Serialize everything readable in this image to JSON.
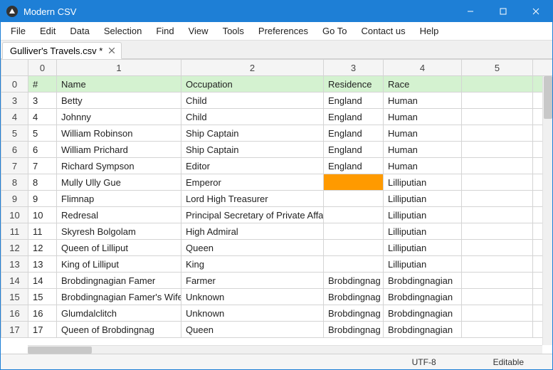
{
  "app": {
    "title": "Modern CSV"
  },
  "window_controls": {
    "min": "min",
    "max": "max",
    "close": "close"
  },
  "menu": [
    "File",
    "Edit",
    "Data",
    "Selection",
    "Find",
    "View",
    "Tools",
    "Preferences",
    "Go To",
    "Contact us",
    "Help"
  ],
  "tab": {
    "label": "Gulliver's Travels.csv *"
  },
  "columns": {
    "rowhdr": "",
    "c0": "0",
    "c1": "1",
    "c2": "2",
    "c3": "3",
    "c4": "4",
    "c5": "5",
    "c6": ""
  },
  "header_row": {
    "idx": "0",
    "c0": "#",
    "c1": "Name",
    "c2": "Occupation",
    "c3": "Residence",
    "c4": "Race",
    "c5": "",
    "c6": ""
  },
  "rows": [
    {
      "idx": "3",
      "c0": "3",
      "c1": "Betty",
      "c2": "Child",
      "c3": "England",
      "c4": "Human",
      "c5": "",
      "c6": ""
    },
    {
      "idx": "4",
      "c0": "4",
      "c1": "Johnny",
      "c2": "Child",
      "c3": "England",
      "c4": "Human",
      "c5": "",
      "c6": ""
    },
    {
      "idx": "5",
      "c0": "5",
      "c1": "William Robinson",
      "c2": "Ship Captain",
      "c3": "England",
      "c4": "Human",
      "c5": "",
      "c6": ""
    },
    {
      "idx": "6",
      "c0": "6",
      "c1": "William Prichard",
      "c2": "Ship Captain",
      "c3": "England",
      "c4": "Human",
      "c5": "",
      "c6": ""
    },
    {
      "idx": "7",
      "c0": "7",
      "c1": "Richard Sympson",
      "c2": "Editor",
      "c3": "England",
      "c4": "Human",
      "c5": "",
      "c6": ""
    },
    {
      "idx": "8",
      "c0": "8",
      "c1": "Mully Ully Gue",
      "c2": "Emperor",
      "c3": "",
      "c4": "Lilliputian",
      "c5": "",
      "c6": "",
      "hl": "c3"
    },
    {
      "idx": "9",
      "c0": "9",
      "c1": "Flimnap",
      "c2": "Lord High Treasurer",
      "c3": "",
      "c4": "Lilliputian",
      "c5": "",
      "c6": ""
    },
    {
      "idx": "10",
      "c0": "10",
      "c1": "Redresal",
      "c2": "Principal Secretary of Private Affairs",
      "c3": "",
      "c4": "Lilliputian",
      "c5": "",
      "c6": ""
    },
    {
      "idx": "11",
      "c0": "11",
      "c1": "Skyresh Bolgolam",
      "c2": "High Admiral",
      "c3": "",
      "c4": "Lilliputian",
      "c5": "",
      "c6": ""
    },
    {
      "idx": "12",
      "c0": "12",
      "c1": "Queen of Lilliput",
      "c2": "Queen",
      "c3": "",
      "c4": "Lilliputian",
      "c5": "",
      "c6": ""
    },
    {
      "idx": "13",
      "c0": "13",
      "c1": "King of Lilliput",
      "c2": "King",
      "c3": "",
      "c4": "Lilliputian",
      "c5": "",
      "c6": ""
    },
    {
      "idx": "14",
      "c0": "14",
      "c1": "Brobdingnagian Famer",
      "c2": "Farmer",
      "c3": "Brobdingnag",
      "c4": "Brobdingnagian",
      "c5": "",
      "c6": ""
    },
    {
      "idx": "15",
      "c0": "15",
      "c1": "Brobdingnagian Famer's Wife",
      "c2": "Unknown",
      "c3": "Brobdingnag",
      "c4": "Brobdingnagian",
      "c5": "",
      "c6": ""
    },
    {
      "idx": "16",
      "c0": "16",
      "c1": "Glumdalclitch",
      "c2": "Unknown",
      "c3": "Brobdingnag",
      "c4": "Brobdingnagian",
      "c5": "",
      "c6": ""
    },
    {
      "idx": "17",
      "c0": "17",
      "c1": "Queen of Brobdingnag",
      "c2": "Queen",
      "c3": "Brobdingnag",
      "c4": "Brobdingnagian",
      "c5": "",
      "c6": "",
      "cut": true
    }
  ],
  "status": {
    "encoding": "UTF-8",
    "mode": "Editable"
  }
}
